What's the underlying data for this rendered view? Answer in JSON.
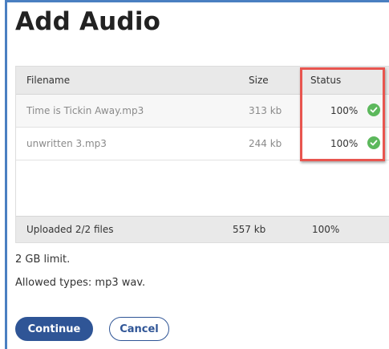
{
  "page": {
    "title": "Add Audio"
  },
  "table": {
    "headers": {
      "filename": "Filename",
      "size": "Size",
      "status": "Status"
    },
    "rows": [
      {
        "filename": "Time is Tickin Away.mp3",
        "size": "313 kb",
        "status": "100%",
        "icon": "check-circle-icon"
      },
      {
        "filename": "unwritten 3.mp3",
        "size": "244 kb",
        "status": "100%",
        "icon": "check-circle-icon"
      }
    ],
    "footer": {
      "uploaded": "Uploaded 2/2 files",
      "total_size": "557 kb",
      "total_status": "100%"
    }
  },
  "notes": {
    "limit": "2 GB limit.",
    "allowed_types": "Allowed types: mp3 wav."
  },
  "actions": {
    "continue_label": "Continue",
    "cancel_label": "Cancel"
  },
  "colors": {
    "primary": "#2f5596",
    "success": "#5cb85c",
    "highlight": "#e8554f",
    "frame": "#4a7fc1"
  }
}
